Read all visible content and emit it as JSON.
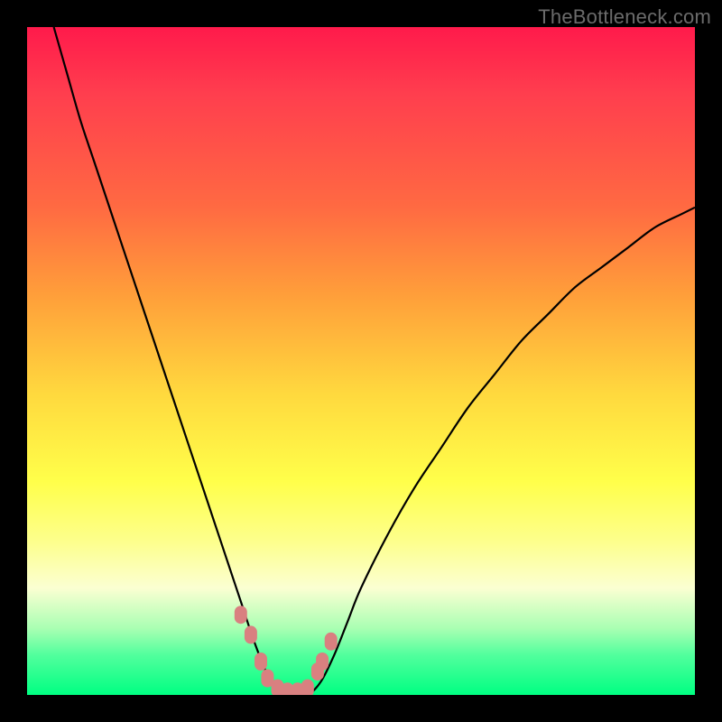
{
  "watermark": "TheBottleneck.com",
  "colors": {
    "frame": "#000000",
    "curve_stroke": "#000000",
    "marker_fill": "#d98080",
    "marker_stroke": "#d98080"
  },
  "chart_data": {
    "type": "line",
    "title": "",
    "xlabel": "",
    "ylabel": "",
    "xlim": [
      0,
      100
    ],
    "ylim": [
      0,
      100
    ],
    "grid": false,
    "legend": false,
    "notes": "V-shaped bottleneck curve on rainbow gradient; y≈100 means severe bottleneck (top/red), y≈0 means no bottleneck (bottom/green). Minimum (near 0) around x≈37–42.",
    "series": [
      {
        "name": "bottleneck-curve",
        "x": [
          4,
          6,
          8,
          10,
          12,
          14,
          16,
          18,
          20,
          22,
          24,
          26,
          28,
          30,
          32,
          34,
          36,
          38,
          40,
          42,
          44,
          46,
          48,
          50,
          54,
          58,
          62,
          66,
          70,
          74,
          78,
          82,
          86,
          90,
          94,
          98,
          100
        ],
        "y": [
          100,
          93,
          86,
          80,
          74,
          68,
          62,
          56,
          50,
          44,
          38,
          32,
          26,
          20,
          14,
          8,
          3,
          0,
          0,
          0,
          2,
          6,
          11,
          16,
          24,
          31,
          37,
          43,
          48,
          53,
          57,
          61,
          64,
          67,
          70,
          72,
          73
        ]
      },
      {
        "name": "highlighted-points",
        "type": "scatter",
        "x": [
          32,
          33.5,
          35,
          36,
          37.5,
          39,
          40.5,
          42,
          43.5,
          44.2,
          45.5
        ],
        "y": [
          12,
          9,
          5,
          2.5,
          1,
          0.5,
          0.5,
          1,
          3.5,
          5,
          8
        ]
      }
    ]
  }
}
